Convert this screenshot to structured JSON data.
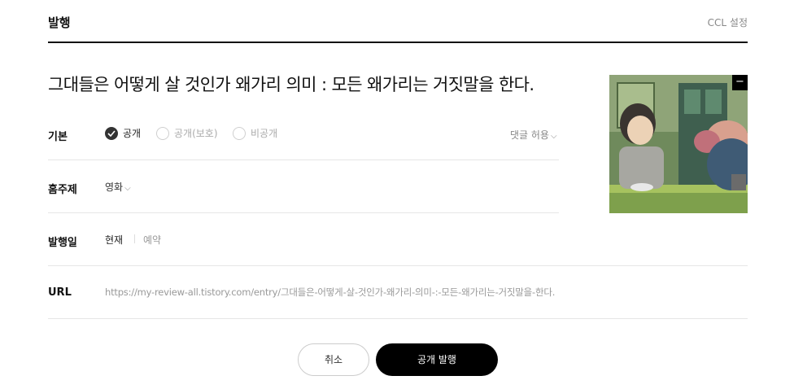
{
  "header": {
    "title": "발행",
    "ccl_label": "CCL 설정"
  },
  "post": {
    "title": "그대들은 어떻게 살 것인가 왜가리 의미 : 모든 왜가리는 거짓말을 한다."
  },
  "thumbnail": {
    "remove_symbol": "−"
  },
  "visibility": {
    "label": "기본",
    "options": [
      {
        "label": "공개",
        "selected": true
      },
      {
        "label": "공개(보호)",
        "selected": false
      },
      {
        "label": "비공개",
        "selected": false
      }
    ],
    "comment_permission": "댓글 허용"
  },
  "category": {
    "label": "홈주제",
    "value": "영화"
  },
  "publish_date": {
    "label": "발행일",
    "now": "현재",
    "reserve": "예약"
  },
  "url": {
    "label": "URL",
    "value": "https://my-review-all.tistory.com/entry/그대들은-어떻게-살-것인가-왜가리-의미-:-모든-왜가리는-거짓말을-한다."
  },
  "buttons": {
    "cancel": "취소",
    "publish": "공개 발행"
  },
  "colors": {
    "primary_button": "#000000",
    "divider": "#e6e6e6",
    "muted_text": "#999999"
  }
}
